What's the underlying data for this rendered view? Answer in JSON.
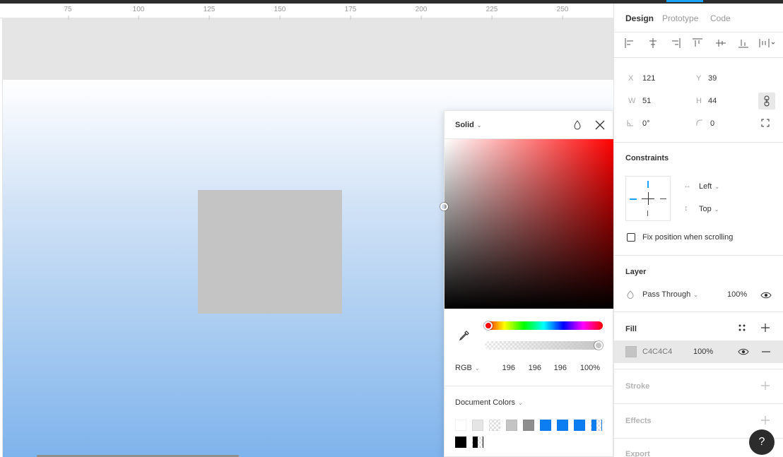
{
  "ruler": {
    "ticks": [
      "75",
      "100",
      "125",
      "150",
      "175",
      "200",
      "225",
      "250"
    ]
  },
  "picker": {
    "fill_type": "Solid",
    "mode": "RGB",
    "r": "196",
    "g": "196",
    "b": "196",
    "alpha": "100%",
    "document_colors_label": "Document Colors",
    "swatches_row1": [
      "#ffffff",
      "#e5e5e5",
      "checker",
      "#c4c4c4",
      "#8e8e8e",
      "#0d7ef2",
      "#0d7ef2",
      "#0d7ef2",
      "checker-blue"
    ],
    "swatches_row2": [
      "#000000",
      "checker-black"
    ]
  },
  "panel": {
    "tabs": [
      "Design",
      "Prototype",
      "Code"
    ],
    "x_label": "X",
    "x_value": "121",
    "y_label": "Y",
    "y_value": "39",
    "w_label": "W",
    "w_value": "51",
    "h_label": "H",
    "h_value": "44",
    "rotation_value": "0°",
    "radius_value": "0",
    "constraints_title": "Constraints",
    "constraint_h": "Left",
    "constraint_v": "Top",
    "fix_position_label": "Fix position when scrolling",
    "layer_title": "Layer",
    "blend_mode": "Pass Through",
    "layer_opacity": "100%",
    "fill_title": "Fill",
    "fill_hex": "C4C4C4",
    "fill_opacity": "100%",
    "stroke_title": "Stroke",
    "effects_title": "Effects",
    "export_title": "Export"
  },
  "help_label": "?",
  "colors": {
    "accent": "#18a0fb",
    "fill": "#c4c4c4"
  }
}
